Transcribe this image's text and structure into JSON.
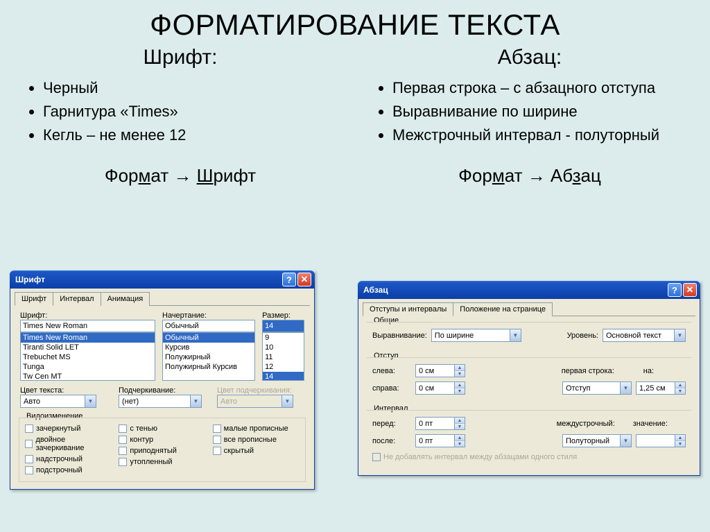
{
  "title": "ФОРМАТИРОВАНИЕ ТЕКСТА",
  "left": {
    "heading": "Шрифт:",
    "bullets": [
      "Черный",
      "Гарнитура «Times»",
      "Кегль – не менее 12"
    ],
    "path_pre": "Фор",
    "path_m": "м",
    "path_mid": "ат → ",
    "path_sh": "Ш",
    "path_post": "рифт"
  },
  "right": {
    "heading": "Абзац:",
    "bullets": [
      "Первая строка – с абзацного отступа",
      "Выравнивание по ширине",
      "Межстрочный интервал - полуторный"
    ],
    "path_pre": "Фор",
    "path_m": "м",
    "path_mid": "ат → Аб",
    "path_z": "з",
    "path_post": "ац"
  },
  "fontDlg": {
    "title": "Шрифт",
    "tabs": [
      "Шрифт",
      "Интервал",
      "Анимация"
    ],
    "lblFont": "Шрифт:",
    "lblStyle": "Начертание:",
    "lblSize": "Размер:",
    "fontValue": "Times New Roman",
    "fontList": [
      "Times New Roman",
      "Tiranti Solid LET",
      "Trebuchet MS",
      "Tunga",
      "Tw Cen MT"
    ],
    "styleValue": "Обычный",
    "styleList": [
      "Обычный",
      "Курсив",
      "Полужирный",
      "Полужирный Курсив"
    ],
    "sizeValue": "14",
    "sizeList": [
      "9",
      "10",
      "11",
      "12",
      "14"
    ],
    "lblTextColor": "Цвет текста:",
    "textColor": "Авто",
    "lblUnderline": "Подчеркивание:",
    "underline": "(нет)",
    "lblUnderColor": "Цвет подчеркивания:",
    "underColor": "Авто",
    "effectsTitle": "Видоизменение",
    "effects": {
      "c1": [
        "зачеркнутый",
        "двойное зачеркивание",
        "надстрочный",
        "подстрочный"
      ],
      "c2": [
        "с тенью",
        "контур",
        "приподнятый",
        "утопленный"
      ],
      "c3": [
        "малые прописные",
        "все прописные",
        "скрытый"
      ]
    }
  },
  "paraDlg": {
    "title": "Абзац",
    "tabs": [
      "Отступы и интервалы",
      "Положение на странице"
    ],
    "grpGeneral": "Общие",
    "lblAlign": "Выравнивание:",
    "align": "По ширине",
    "lblLevel": "Уровень:",
    "level": "Основной текст",
    "grpIndent": "Отступ",
    "lblLeft": "слева:",
    "leftVal": "0 см",
    "lblRight": "справа:",
    "rightVal": "0 см",
    "lblFirstLine": "первая строка:",
    "firstLine": "Отступ",
    "lblBy": "на:",
    "by": "1,25 см",
    "grpSpacing": "Интервал",
    "lblBefore": "перед:",
    "before": "0 пт",
    "lblAfter": "после:",
    "after": "0 пт",
    "lblLineSpacing": "междустрочный:",
    "lineSpacing": "Полуторный",
    "lblValue": "значение:",
    "chkSameStyle": "Не добавлять интервал между абзацами одного стиля"
  }
}
